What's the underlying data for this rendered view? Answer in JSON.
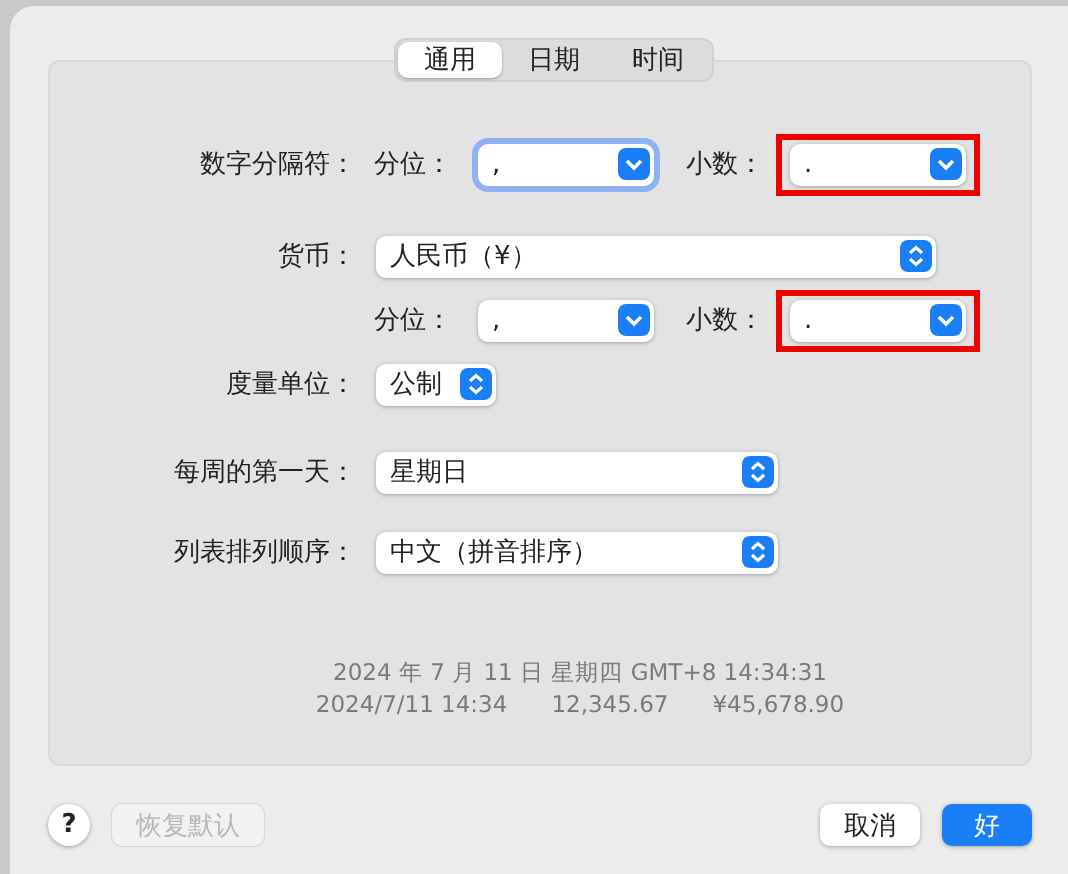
{
  "tabs": [
    {
      "label": "通用",
      "selected": true
    },
    {
      "label": "日期",
      "selected": false
    },
    {
      "label": "时间",
      "selected": false
    }
  ],
  "rows": [
    {
      "label": "数字分隔符：",
      "controls": [
        {
          "label": "分位：",
          "value": ",",
          "kind": "pulldown",
          "focused": true,
          "highlighted": false
        },
        {
          "label": "小数：",
          "value": ".",
          "kind": "pulldown",
          "focused": false,
          "highlighted": true
        }
      ]
    },
    {
      "label": "货币：",
      "controls": [
        {
          "value": "人民币（¥）",
          "kind": "popup",
          "focused": false,
          "highlighted": false
        }
      ]
    },
    {
      "controls": [
        {
          "label": "分位：",
          "value": ",",
          "kind": "pulldown",
          "focused": false,
          "highlighted": false
        },
        {
          "label": "小数：",
          "value": ".",
          "kind": "pulldown",
          "focused": false,
          "highlighted": true
        }
      ]
    },
    {
      "label": "度量单位：",
      "controls": [
        {
          "value": "公制",
          "kind": "popup",
          "focused": false,
          "highlighted": false
        }
      ]
    },
    {
      "label": "每周的第一天：",
      "controls": [
        {
          "value": "星期日",
          "kind": "popup",
          "focused": false,
          "highlighted": false
        }
      ]
    },
    {
      "label": "列表排列顺序：",
      "controls": [
        {
          "value": "中文（拼音排序）",
          "kind": "popup",
          "focused": false,
          "highlighted": false
        }
      ]
    }
  ],
  "samples": [
    "2024 年 7 月 11 日 星期四 GMT+8 14:34:31",
    [
      "2024/7/11 14:34",
      "12,345.67",
      "¥45,678.90"
    ]
  ],
  "help": "?",
  "restore_button": {
    "label": "恢复默认",
    "disabled": true
  },
  "cancel_button": {
    "label": "取消"
  },
  "ok_button": {
    "label": "好"
  }
}
